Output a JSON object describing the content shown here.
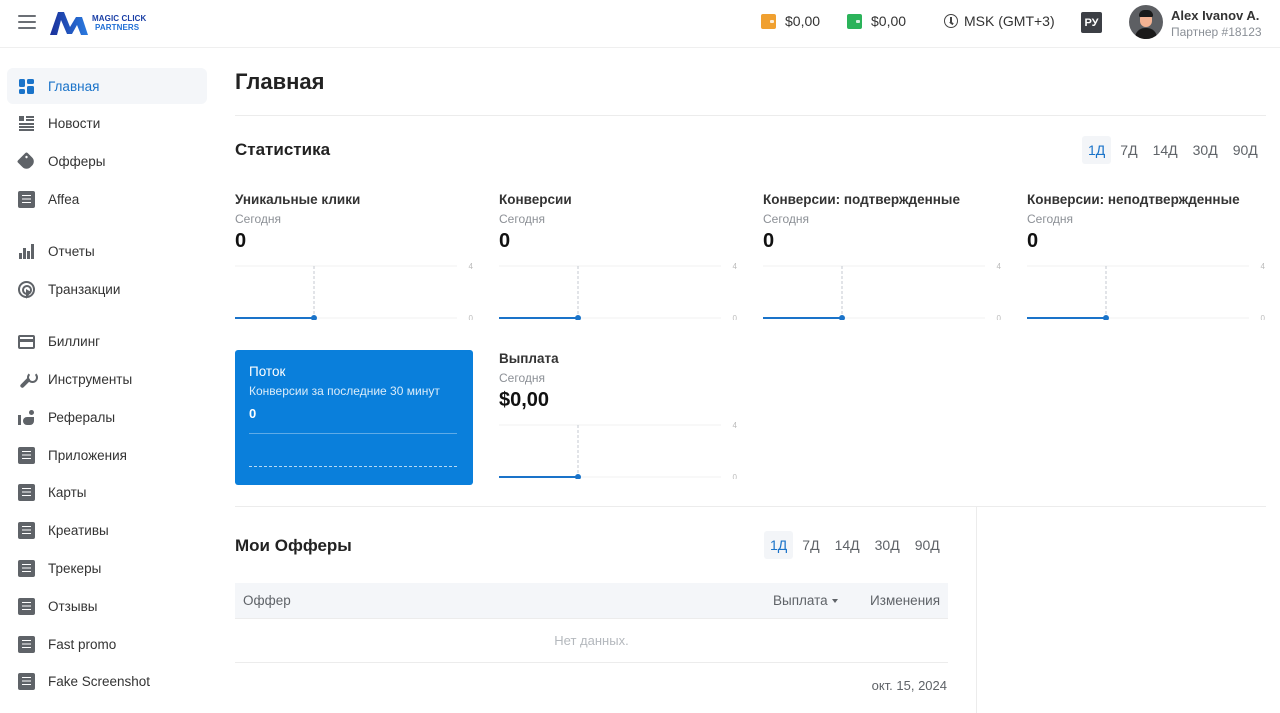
{
  "header": {
    "logo_line1": "MAGIC CLICK",
    "logo_line2": "PARTNERS",
    "balance_main": "$0,00",
    "balance_main_color": "#f0a030",
    "balance_secondary": "$0,00",
    "balance_secondary_color": "#2bb35a",
    "timezone": "MSK (GMT+3)",
    "language": "РУ",
    "user_name": "Alex Ivanov A.",
    "user_sub": "Партнер #18123"
  },
  "sidebar": {
    "items": [
      {
        "label": "Главная",
        "icon": "dashboard-icon",
        "active": true
      },
      {
        "label": "Новости",
        "icon": "news-icon"
      },
      {
        "label": "Офферы",
        "icon": "tag-icon"
      },
      {
        "label": "Affea",
        "icon": "document-icon"
      },
      {
        "label": "Отчеты",
        "icon": "bar-chart-icon"
      },
      {
        "label": "Транзакции",
        "icon": "touch-icon"
      },
      {
        "label": "Биллинг",
        "icon": "credit-card-icon"
      },
      {
        "label": "Инструменты",
        "icon": "wrench-icon"
      },
      {
        "label": "Рефералы",
        "icon": "referrals-icon"
      },
      {
        "label": "Приложения",
        "icon": "document-icon"
      },
      {
        "label": "Карты",
        "icon": "document-icon"
      },
      {
        "label": "Креативы",
        "icon": "document-icon"
      },
      {
        "label": "Трекеры",
        "icon": "document-icon"
      },
      {
        "label": "Отзывы",
        "icon": "document-icon"
      },
      {
        "label": "Fast promo",
        "icon": "document-icon"
      },
      {
        "label": "Fake Screenshot",
        "icon": "document-icon"
      }
    ]
  },
  "main": {
    "page_title": "Главная",
    "stats": {
      "title": "Статистика",
      "periods": [
        "1Д",
        "7Д",
        "14Д",
        "30Д",
        "90Д"
      ],
      "active_period": "1Д",
      "cards": [
        {
          "title": "Уникальные клики",
          "sub": "Сегодня",
          "value": "0",
          "axis_max": "4",
          "axis_min": "0"
        },
        {
          "title": "Конверсии",
          "sub": "Сегодня",
          "value": "0",
          "axis_max": "4",
          "axis_min": "0"
        },
        {
          "title": "Конверсии: подтвержденные",
          "sub": "Сегодня",
          "value": "0",
          "axis_max": "4",
          "axis_min": "0"
        },
        {
          "title": "Конверсии: неподтвержденные",
          "sub": "Сегодня",
          "value": "0",
          "axis_max": "4",
          "axis_min": "0"
        },
        {
          "title": "Выплата",
          "sub": "Сегодня",
          "value": "$0,00",
          "axis_max": "4",
          "axis_min": "0"
        }
      ],
      "flow": {
        "title": "Поток",
        "sub": "Конверсии за последние 30 минут",
        "value": "0"
      }
    },
    "offers": {
      "title": "Мои Офферы",
      "periods": [
        "1Д",
        "7Д",
        "14Д",
        "30Д",
        "90Д"
      ],
      "active_period": "1Д",
      "columns": [
        "Оффер",
        "Выплата",
        "Изменения"
      ],
      "empty_text": "Нет данных.",
      "date": "окт. 15, 2024"
    },
    "accent_color": "#1a73c9"
  }
}
